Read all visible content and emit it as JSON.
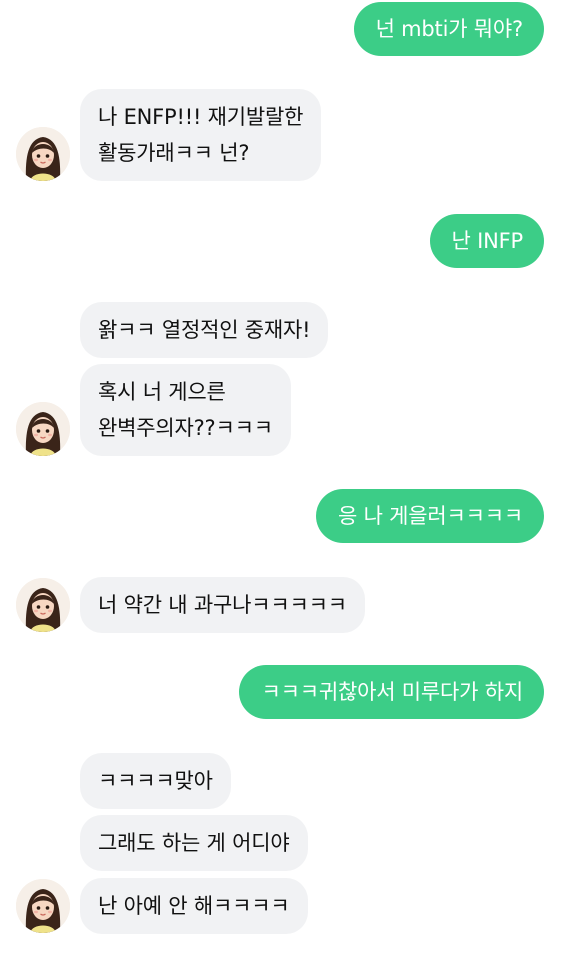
{
  "conversation": {
    "messages": [
      {
        "sender": "me",
        "text": "넌 mbti가 뭐야?"
      },
      {
        "sender": "friend",
        "text": "나 ENFP!!! 재기발랄한\n활동가래ㅋㅋ 넌?"
      },
      {
        "sender": "me",
        "text": "난 INFP"
      },
      {
        "sender": "friend",
        "text": "왉ㅋㅋ 열정적인 중재자!"
      },
      {
        "sender": "friend",
        "text": "혹시 너 게으른\n완벽주의자??ㅋㅋㅋ"
      },
      {
        "sender": "me",
        "text": "응 나 게을러ㅋㅋㅋㅋ"
      },
      {
        "sender": "friend",
        "text": "너 약간 내 과구나ㅋㅋㅋㅋㅋ"
      },
      {
        "sender": "me",
        "text": "ㅋㅋㅋ귀찮아서 미루다가 하지"
      },
      {
        "sender": "friend",
        "text": "ㅋㅋㅋㅋ맞아"
      },
      {
        "sender": "friend",
        "text": "그래도 하는 게 어디야"
      },
      {
        "sender": "friend",
        "text": "난 아예 안 해ㅋㅋㅋㅋ"
      }
    ],
    "friend_avatar_icon": "girl-avatar-icon",
    "colors": {
      "outgoing_bubble": "#3ccd87",
      "outgoing_text": "#ffffff",
      "incoming_bubble": "#f1f2f4",
      "incoming_text": "#111111",
      "background": "#ffffff"
    }
  }
}
